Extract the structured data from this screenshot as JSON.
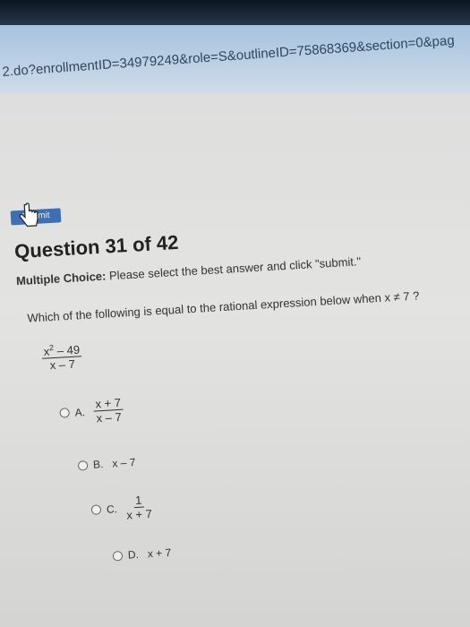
{
  "browser": {
    "url_fragment": "2.do?enrollmentID=34979249&role=S&outlineID=75868369&section=0&pag"
  },
  "quiz": {
    "submit_label": "Submit",
    "question_title": "Question 31 of 42",
    "instruction_bold": "Multiple Choice:",
    "instruction_text": " Please select the best answer and click \"submit.\"",
    "prompt": "Which of the following is equal to the rational expression below when  x ≠ 7 ?",
    "expression": {
      "numerator_base": "x",
      "numerator_exp": "2",
      "numerator_rest": " – 49",
      "denominator": "x – 7"
    },
    "options": [
      {
        "letter": "A.",
        "numerator": "x + 7",
        "denominator": "x – 7"
      },
      {
        "letter": "B.",
        "text": "x – 7"
      },
      {
        "letter": "C.",
        "numerator": "1",
        "denominator": "x + 7"
      },
      {
        "letter": "D.",
        "text": "x + 7"
      }
    ]
  }
}
